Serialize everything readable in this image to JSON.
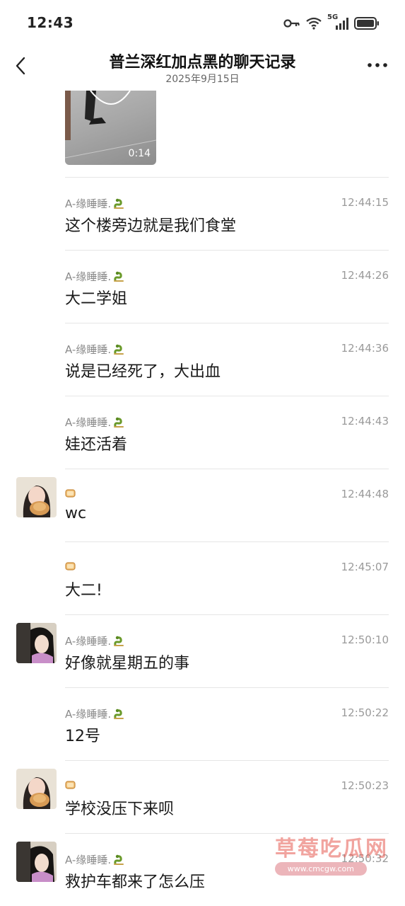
{
  "status_bar": {
    "time": "12:43",
    "network": "5G"
  },
  "header": {
    "title": "普兰深红加点黑的聊天记录",
    "date": "2025年9月15日"
  },
  "video": {
    "duration": "0:14"
  },
  "senders": {
    "a": "A-缘睡睡."
  },
  "messages": [
    {
      "sender": "A-缘睡睡.",
      "time": "12:44:15",
      "text": "这个楼旁边就是我们食堂",
      "avatar": false,
      "emoji": "snake"
    },
    {
      "sender": "A-缘睡睡.",
      "time": "12:44:26",
      "text": "大二学姐",
      "avatar": false,
      "emoji": "snake"
    },
    {
      "sender": "A-缘睡睡.",
      "time": "12:44:36",
      "text": "说是已经死了，大出血",
      "avatar": false,
      "emoji": "snake"
    },
    {
      "sender": "A-缘睡睡.",
      "time": "12:44:43",
      "text": "娃还活着",
      "avatar": false,
      "emoji": "snake"
    },
    {
      "sender": "",
      "time": "12:44:48",
      "text": "wc",
      "avatar": "girl",
      "emoji": "bread"
    },
    {
      "sender": "",
      "time": "12:45:07",
      "text": "大二!",
      "avatar": false,
      "emoji": "bread"
    },
    {
      "sender": "A-缘睡睡.",
      "time": "12:50:10",
      "text": "好像就星期五的事",
      "avatar": "anime",
      "emoji": "snake"
    },
    {
      "sender": "A-缘睡睡.",
      "time": "12:50:22",
      "text": "12号",
      "avatar": false,
      "emoji": "snake"
    },
    {
      "sender": "",
      "time": "12:50:23",
      "text": "学校没压下来呗",
      "avatar": "girl",
      "emoji": "bread"
    },
    {
      "sender": "A-缘睡睡.",
      "time": "12:50:32",
      "text": "救护车都来了怎么压",
      "avatar": "anime",
      "emoji": "snake"
    }
  ],
  "watermark": {
    "main": "草莓吃瓜网",
    "sub": "www.cmcgw.com"
  }
}
